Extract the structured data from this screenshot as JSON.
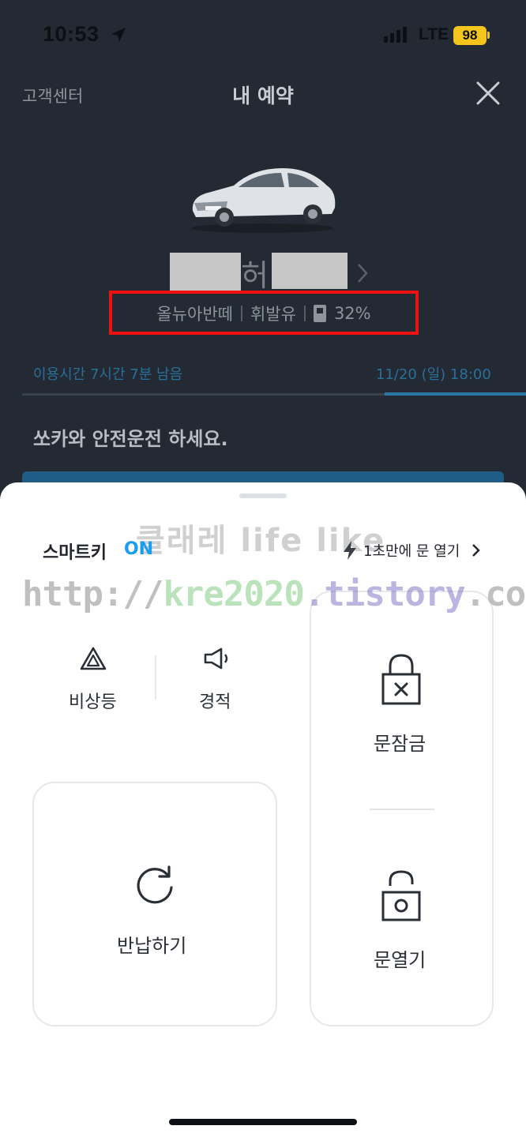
{
  "status_bar": {
    "time": "10:53",
    "network": "LTE",
    "battery": "98"
  },
  "header": {
    "left_link": "고객센터",
    "title": "내 예약",
    "close_icon": "close-icon"
  },
  "car": {
    "plate_visible_char": "허",
    "model": "올뉴아반떼",
    "fuel_type": "휘발유",
    "fuel_level": "32%"
  },
  "usage": {
    "remaining": "이용시간 7시간 7분 남음",
    "end_time": "11/20 (일) 18:00",
    "progress_remaining": 0.28
  },
  "message": "쏘카와 안전운전 하세요.",
  "sheet": {
    "smartkey_label": "스마트키",
    "smartkey_state": "ON",
    "quick_open": "1초만에 문 열기",
    "controls": [
      {
        "label": "비상등",
        "icon": "hazard-icon"
      },
      {
        "label": "경적",
        "icon": "horn-icon"
      }
    ],
    "return_label": "반납하기",
    "lock_label": "문잠금",
    "unlock_label": "문열기"
  },
  "watermark": {
    "title": "클래레 life like",
    "url_parts": [
      "http://",
      "kre2020",
      ".tistory",
      ".com"
    ]
  },
  "colors": {
    "accent": "#1a9cf0",
    "highlight_box": "#ee1111",
    "dark_bg": "#232a33"
  }
}
